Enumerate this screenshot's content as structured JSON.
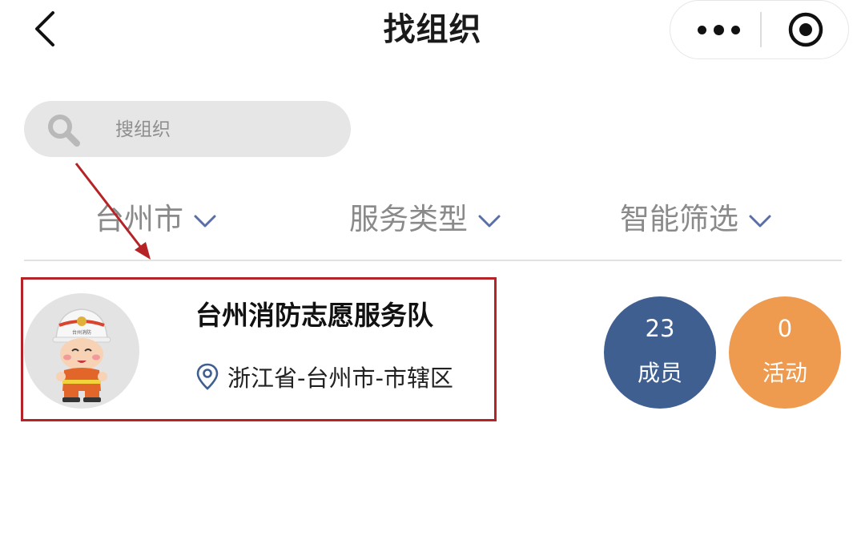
{
  "nav": {
    "title": "找组织",
    "back_icon": "chevron-left-icon",
    "more_icon": "more-dots-icon",
    "close_icon": "target-circle-icon"
  },
  "search": {
    "placeholder": "搜组织",
    "value": "",
    "icon": "search-icon"
  },
  "filters": [
    {
      "label": "台州市",
      "icon": "chevron-down-icon"
    },
    {
      "label": "服务类型",
      "icon": "chevron-down-icon"
    },
    {
      "label": "智能筛选",
      "icon": "chevron-down-icon"
    }
  ],
  "org": {
    "name": "台州消防志愿服务队",
    "location": "浙江省-台州市-市辖区",
    "location_icon": "map-pin-icon",
    "members": {
      "count": "23",
      "label": "成员"
    },
    "activities": {
      "count": "0",
      "label": "活动"
    }
  },
  "colors": {
    "accent_blue": "#3f5f91",
    "accent_orange": "#ee9a4f",
    "chevron_blue": "#5a6fa8",
    "highlight_red": "#b52326",
    "search_bg": "#e6e6e6"
  }
}
